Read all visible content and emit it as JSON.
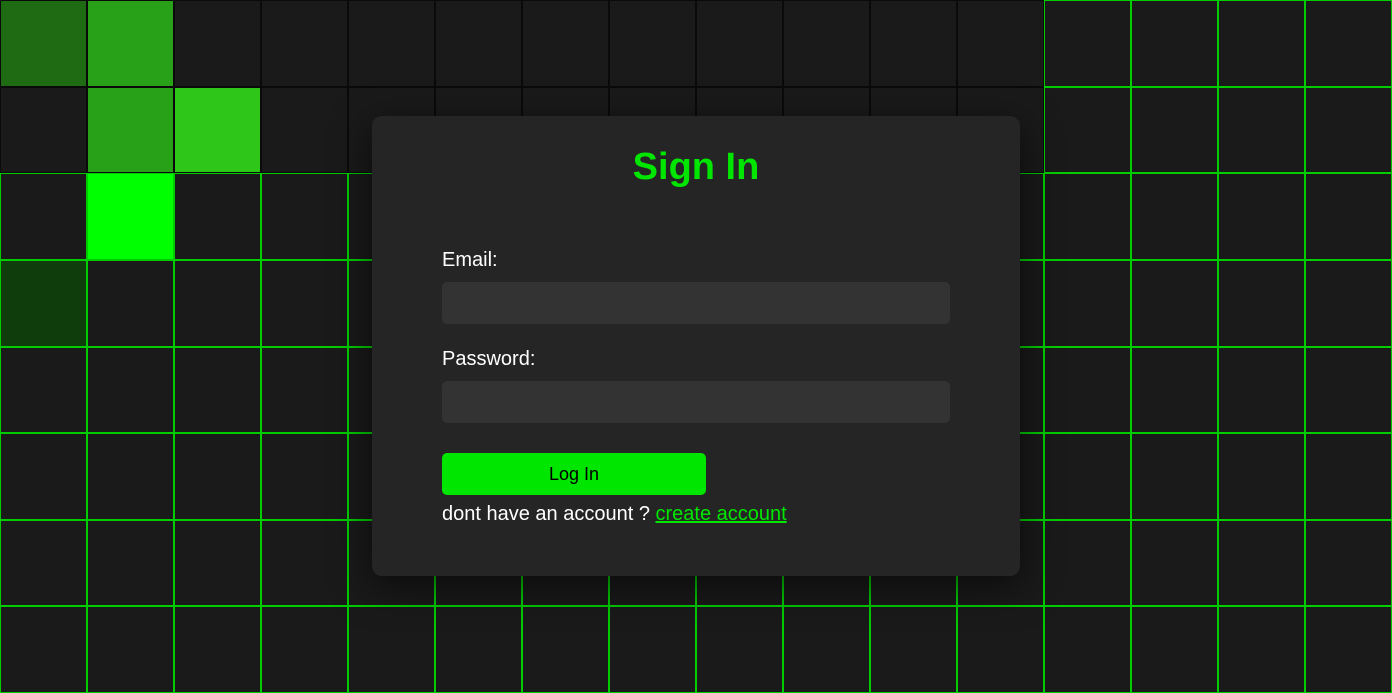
{
  "signin": {
    "title": "Sign In",
    "email_label": "Email:",
    "email_value": "",
    "password_label": "Password:",
    "password_value": "",
    "login_button": "Log In",
    "signup_prompt": "dont have an account ? ",
    "signup_link": "create account"
  }
}
